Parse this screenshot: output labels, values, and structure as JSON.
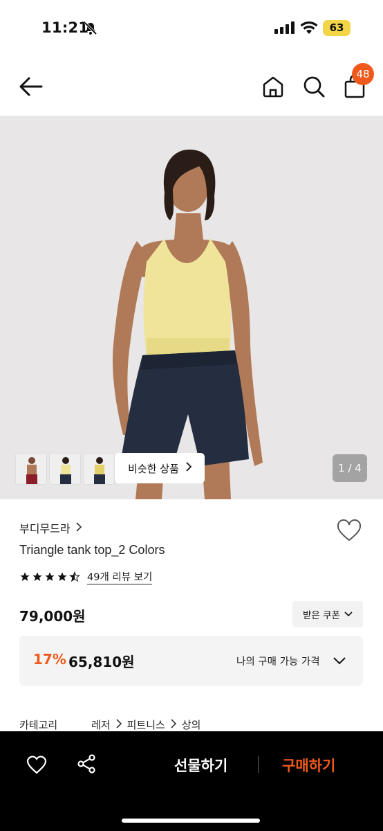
{
  "status_bar": {
    "time": "11:21",
    "battery": "63"
  },
  "header": {
    "cart_count": "48"
  },
  "hero": {
    "similar_label": "비슷한 상품",
    "page_indicator": "1 / 4"
  },
  "product": {
    "brand": "부디무드라",
    "name": "Triangle tank top_2 Colors",
    "rating": 4.5,
    "review_link": "49개 리뷰 보기",
    "price": "79,000원",
    "coupon_label": "받은 쿠폰",
    "discount_percent": "17%",
    "discount_price": "65,810원",
    "my_price_label": "나의 구매 가능 가격"
  },
  "category": {
    "label": "카테고리",
    "path": [
      "레저",
      "피트니스",
      "상의"
    ]
  },
  "bottom_bar": {
    "gift_label": "선물하기",
    "buy_label": "구매하기"
  },
  "colors": {
    "accent": "#ef5a1c",
    "battery": "#f3d548",
    "tank_yellow": "#efe49a",
    "shorts_navy": "#252d40"
  }
}
